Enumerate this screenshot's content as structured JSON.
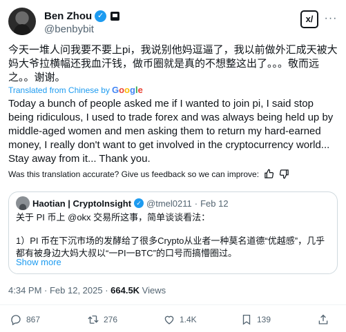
{
  "author": {
    "name": "Ben Zhou",
    "handle": "@benbybit",
    "verified_mark": "✓"
  },
  "header": {
    "xai_label": "x/",
    "more_label": "···"
  },
  "tweet": {
    "original_text": "今天一堆人问我要不要上pi，我说别他妈逗逼了，我以前做外汇成天被大妈大爷拉横幅还我血汗钱，做币圈就是真的不想整这出了。。。敬而远之。。谢谢。",
    "translated_label": "Translated from Chinese by",
    "google_logo": "Google",
    "translated_text": "Today a bunch of people asked me if I wanted to join pi, I said stop being ridiculous, I used to trade forex and was always being held up by middle-aged women and men asking them to return my hard-earned money, I really don't want to get involved in the cryptocurrency world... Stay away from it... Thank you.",
    "feedback_prompt": "Was this translation accurate? Give us feedback so we can improve:"
  },
  "quote": {
    "name": "Haotian | CryptoInsight",
    "handle": "@tmel0211",
    "date": "Feb 12",
    "line1": "关于 PI 币上 @okx 交易所这事，简单谈谈看法：",
    "line2": "1）PI 币在下沉市场的发酵给了很多Crypto从业者一种莫名道德“优越感”，几乎都有被身边大妈大叔以“一PI一BTC”的口号而搞懵圈过。",
    "show_more": "Show more"
  },
  "meta": {
    "time": "4:34 PM · Feb 12, 2025 · ",
    "views_count": "664.5K",
    "views_label": " Views"
  },
  "actions": {
    "replies": "867",
    "reposts": "276",
    "likes": "1.4K",
    "bookmarks": "139"
  },
  "colors": {
    "accent": "#1d9bf0",
    "muted": "#536471",
    "border": "#cfd9de"
  }
}
